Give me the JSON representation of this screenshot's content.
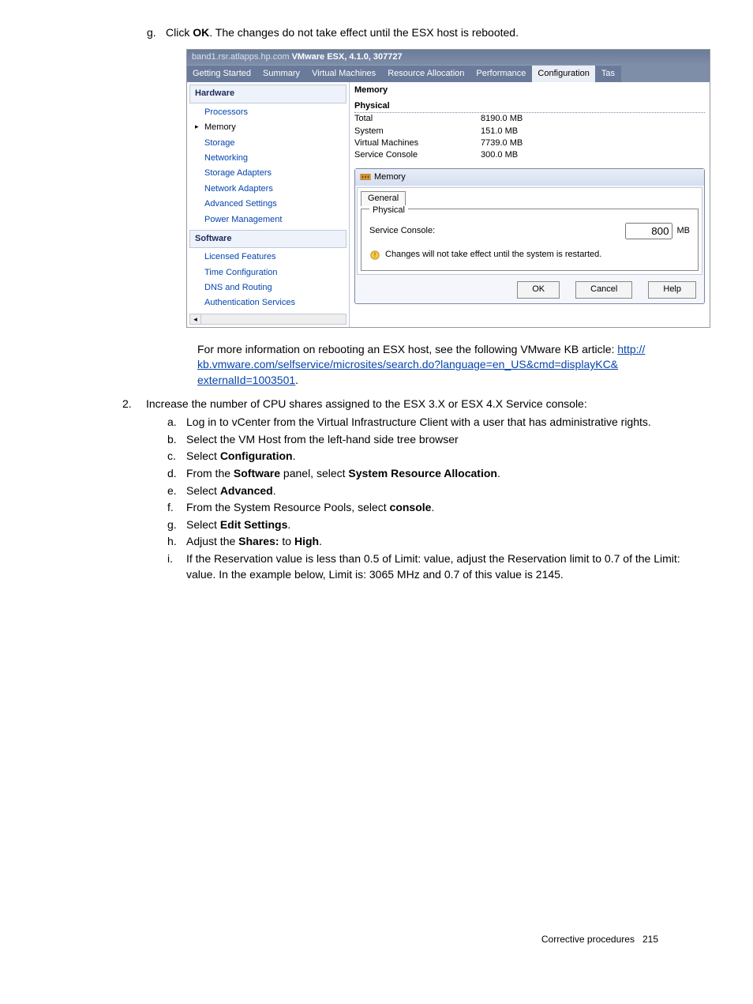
{
  "intro": {
    "letter": "g.",
    "text_before": "Click ",
    "bold": "OK",
    "text_after": ". The changes do not take effect until the ESX host is rebooted."
  },
  "screenshot": {
    "host_prefix": "band1.rsr.atlapps.hp.com",
    "title": "VMware ESX, 4.1.0, 307727",
    "tabs": [
      "Getting Started",
      "Summary",
      "Virtual Machines",
      "Resource Allocation",
      "Performance",
      "Configuration",
      "Tas"
    ],
    "active_tab": "Configuration",
    "hardware_label": "Hardware",
    "hardware_items": [
      "Processors",
      "Memory",
      "Storage",
      "Networking",
      "Storage Adapters",
      "Network Adapters",
      "Advanced Settings",
      "Power Management"
    ],
    "software_label": "Software",
    "software_items": [
      "Licensed Features",
      "Time Configuration",
      "DNS and Routing",
      "Authentication Services"
    ],
    "memory_heading": "Memory",
    "physical_heading": "Physical",
    "rows": [
      {
        "k": "Total",
        "v": "8190.0 MB"
      },
      {
        "k": "System",
        "v": "151.0 MB"
      },
      {
        "k": "Virtual Machines",
        "v": "7739.0 MB"
      },
      {
        "k": "Service Console",
        "v": "300.0 MB"
      }
    ],
    "dialog": {
      "title": "Memory",
      "tab": "General",
      "fieldset": "Physical",
      "service_console_label": "Service Console:",
      "service_console_value": "800",
      "unit": "MB",
      "warning": "Changes will not take effect until the system is restarted.",
      "buttons": [
        "OK",
        "Cancel",
        "Help"
      ]
    }
  },
  "post_text": {
    "lead": "For more information on rebooting an ESX host, see the following VMware KB article: ",
    "link1": "http://",
    "link2": "kb.vmware.com/selfservice/microsites/search.do?language=en_US&cmd=displayKC&",
    "link3": "externalId=1003501",
    "period": "."
  },
  "step2": {
    "num": "2.",
    "text": "Increase the number of CPU shares assigned to the ESX 3.X or ESX 4.X Service console:",
    "subs": [
      {
        "l": "a.",
        "parts": [
          {
            "t": "Log in to vCenter from the Virtual Infrastructure Client with a user that has administrative rights."
          }
        ]
      },
      {
        "l": "b.",
        "parts": [
          {
            "t": "Select the VM Host from the left-hand side tree browser"
          }
        ]
      },
      {
        "l": "c.",
        "parts": [
          {
            "t": "Select "
          },
          {
            "b": "Configuration"
          },
          {
            "t": "."
          }
        ]
      },
      {
        "l": "d.",
        "parts": [
          {
            "t": "From the "
          },
          {
            "b": "Software"
          },
          {
            "t": " panel, select "
          },
          {
            "b": "System Resource Allocation"
          },
          {
            "t": "."
          }
        ]
      },
      {
        "l": "e.",
        "parts": [
          {
            "t": "Select "
          },
          {
            "b": "Advanced"
          },
          {
            "t": "."
          }
        ]
      },
      {
        "l": "f.",
        "parts": [
          {
            "t": "From the System Resource Pools, select "
          },
          {
            "b": "console"
          },
          {
            "t": "."
          }
        ]
      },
      {
        "l": "g.",
        "parts": [
          {
            "t": "Select "
          },
          {
            "b": "Edit Settings"
          },
          {
            "t": "."
          }
        ]
      },
      {
        "l": "h.",
        "parts": [
          {
            "t": "Adjust the "
          },
          {
            "b": "Shares:"
          },
          {
            "t": " to "
          },
          {
            "b": "High"
          },
          {
            "t": "."
          }
        ]
      },
      {
        "l": "i.",
        "parts": [
          {
            "t": "If the Reservation value is less than 0.5 of Limit: value, adjust the Reservation limit to 0.7 of the Limit: value. In the example below, Limit is: 3065 MHz and 0.7 of this value is 2145."
          }
        ]
      }
    ]
  },
  "footer": {
    "section": "Corrective procedures",
    "page": "215"
  }
}
